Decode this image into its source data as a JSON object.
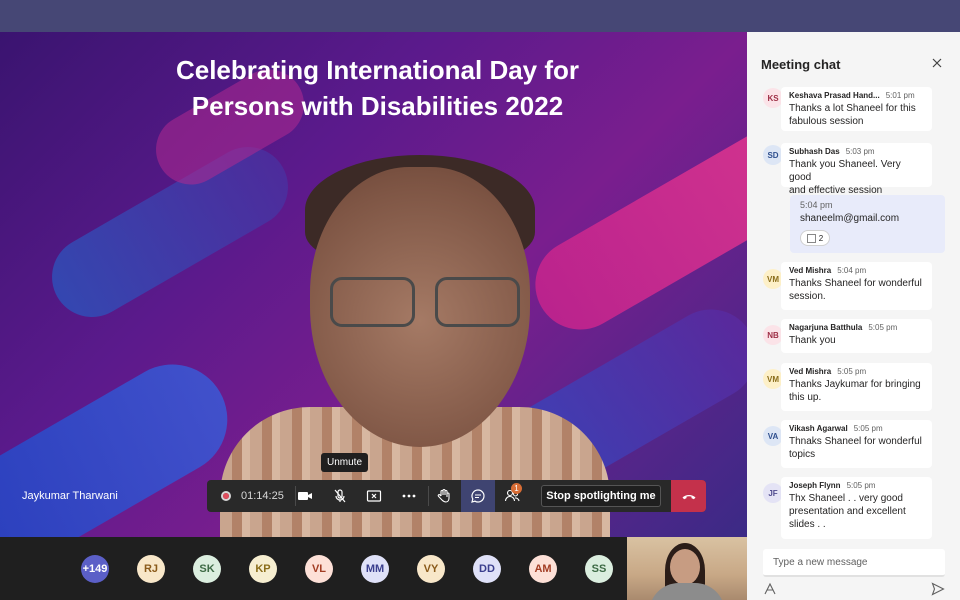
{
  "slide": {
    "title_line1": "Celebrating International Day for",
    "title_line2": "Persons with Disabilities 2022"
  },
  "video": {
    "speaker_name": "Jaykumar Tharwani",
    "tooltip": "Unmute"
  },
  "controls": {
    "recording_time": "01:14:25",
    "people_badge": "1",
    "spotlight_label": "Stop spotlighting me"
  },
  "participants": {
    "more_count": "+149",
    "avatars": [
      "RJ",
      "SK",
      "KP",
      "VL",
      "MM",
      "VY",
      "DD",
      "AM",
      "SS"
    ]
  },
  "chat": {
    "title": "Meeting chat",
    "messages": [
      {
        "initials": "KS",
        "name": "Keshava Prasad Hand...",
        "time": "5:01 pm",
        "line1": "Thanks a lot Shaneel for this",
        "line2": "fabulous session"
      },
      {
        "initials": "SD",
        "name": "Subhash Das",
        "time": "5:03 pm",
        "line1": "Thank you Shaneel. Very good",
        "line2": "and effective session"
      },
      {
        "initials": "VM",
        "name": "Ved Mishra",
        "time": "5:04 pm",
        "line1": "Thanks Shaneel for wonderful",
        "line2": "session."
      },
      {
        "initials": "NB",
        "name": "Nagarjuna Batthula",
        "time": "5:05 pm",
        "line1": "Thank you",
        "line2": ""
      },
      {
        "initials": "VM",
        "name": "Ved Mishra",
        "time": "5:05 pm",
        "line1": "Thanks Jaykumar for bringing",
        "line2": "this up."
      },
      {
        "initials": "VA",
        "name": "Vikash Agarwal",
        "time": "5:05 pm",
        "line1": "Thnaks Shaneel for wonderful",
        "line2": "topics"
      },
      {
        "initials": "JF",
        "name": "Joseph Flynn",
        "time": "5:05 pm",
        "line1": "Thx Shaneel . . very good",
        "line2": "presentation and excellent",
        "line3": "slides . ."
      }
    ],
    "own_message": {
      "time": "5:04 pm",
      "text": "shaneelm@gmail.com",
      "reaction_count": "2"
    },
    "compose_placeholder": "Type a new message"
  }
}
